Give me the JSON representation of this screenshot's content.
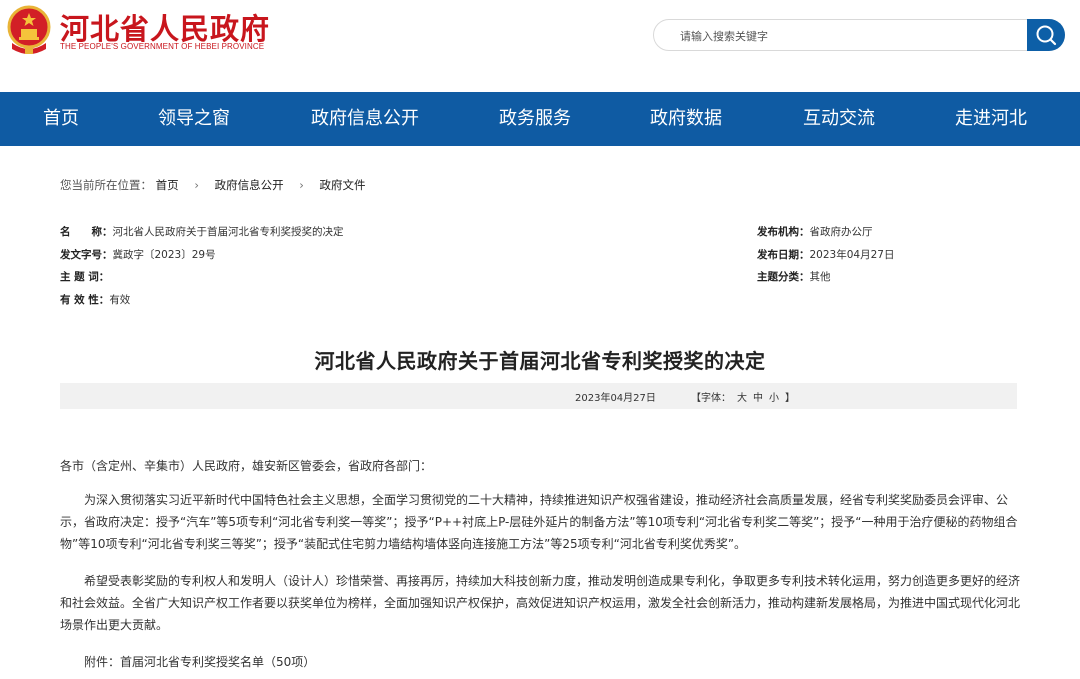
{
  "header": {
    "site_title": "河北省人民政府",
    "site_subtitle": "THE PEOPLE'S GOVERNMENT OF HEBEI PROVINCE",
    "search_placeholder": "请输入搜索关键字"
  },
  "nav": [
    "首页",
    "领导之窗",
    "政府信息公开",
    "政务服务",
    "政府数据",
    "互动交流",
    "走进河北"
  ],
  "breadcrumb": {
    "prefix": "您当前所在位置：",
    "items": [
      "首页",
      "政府信息公开",
      "政府文件"
    ]
  },
  "meta": {
    "name_label": "名　　称：",
    "name_value": "河北省人民政府关于首届河北省专利奖授奖的决定",
    "docno_label": "发文字号：",
    "docno_value": "冀政字〔2023〕29号",
    "keyword_label": "主  题  词：",
    "keyword_value": "",
    "validity_label": "有  效  性：",
    "validity_value": "有效",
    "org_label": "发布机构：",
    "org_value": "省政府办公厅",
    "date_label": "发布日期：",
    "date_value": "2023年04月27日",
    "category_label": "主题分类：",
    "category_value": "其他"
  },
  "article": {
    "title": "河北省人民政府关于首届河北省专利奖授奖的决定",
    "date": "2023年04月27日",
    "font_label": "【字体：",
    "font_large": "大",
    "font_medium": "中",
    "font_small": "小",
    "font_end": "】",
    "salutation": "各市（含定州、辛集市）人民政府，雄安新区管委会，省政府各部门：",
    "para1": "为深入贯彻落实习近平新时代中国特色社会主义思想，全面学习贯彻党的二十大精神，持续推进知识产权强省建设，推动经济社会高质量发展，经省专利奖奖励委员会评审、公示，省政府决定：授予“汽车”等5项专利“河北省专利奖一等奖”；授予“P++衬底上P-层硅外延片的制备方法”等10项专利“河北省专利奖二等奖”；授予“一种用于治疗便秘的药物组合物”等10项专利“河北省专利奖三等奖”；授予“装配式住宅剪力墙结构墙体竖向连接施工方法”等25项专利“河北省专利奖优秀奖”。",
    "para2": "希望受表彰奖励的专利权人和发明人（设计人）珍惜荣誉、再接再厉，持续加大科技创新力度，推动发明创造成果专利化，争取更多专利技术转化运用，努力创造更多更好的经济和社会效益。全省广大知识产权工作者要以获奖单位为榜样，全面加强知识产权保护，高效促进知识产权运用，激发全社会创新活力，推动构建新发展格局，为推进中国式现代化河北场景作出更大贡献。",
    "attachment": "附件：首届河北省专利奖授奖名单（50项）"
  }
}
